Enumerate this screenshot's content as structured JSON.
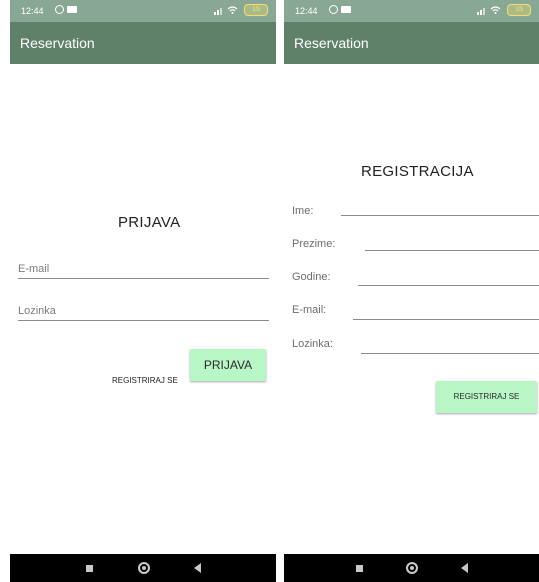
{
  "login_screen": {
    "status_bar": {
      "time": "12:44",
      "battery": "15"
    },
    "app_bar": {
      "title": "Reservation"
    },
    "heading": "PRIJAVA",
    "email_field": {
      "placeholder": "E-mail"
    },
    "password_field": {
      "placeholder": "Lozinka"
    },
    "register_link": "REGISTRIRAJ SE",
    "login_button": "PRIJAVA"
  },
  "register_screen": {
    "status_bar": {
      "time": "12:44",
      "battery": "15"
    },
    "app_bar": {
      "title": "Reservation"
    },
    "heading": "REGISTRACIJA",
    "fields": [
      {
        "label": "Ime:"
      },
      {
        "label": "Prezime:"
      },
      {
        "label": "Godine:"
      },
      {
        "label": "E-mail:"
      },
      {
        "label": "Lozinka:"
      }
    ],
    "register_button": "REGISTRIRAJ SE"
  },
  "colors": {
    "status_bar": "#89a795",
    "app_bar": "#5f8069",
    "button": "#b9f6c6",
    "nav_bar": "#000000"
  },
  "icons": {
    "status": [
      "alarm-icon",
      "notification-icon",
      "signal-icon",
      "wifi-icon",
      "battery-icon"
    ],
    "navigation": [
      "recents-icon",
      "home-icon",
      "back-icon"
    ]
  }
}
